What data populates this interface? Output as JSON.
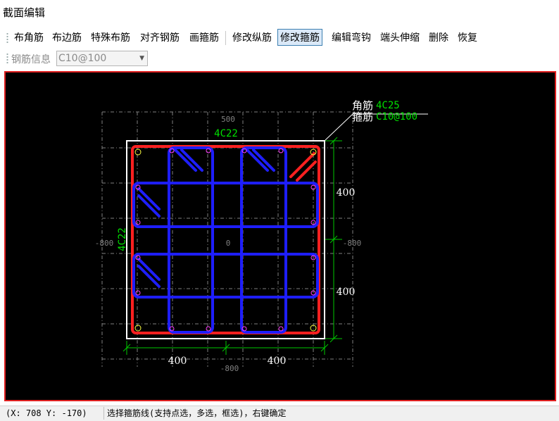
{
  "window": {
    "title": "截面编辑"
  },
  "toolbar": {
    "buttons": [
      "布角筋",
      "布边筋",
      "特殊布筋",
      "对齐钢筋",
      "画箍筋",
      "修改纵筋",
      "修改箍筋",
      "编辑弯钩",
      "端头伸缩",
      "删除",
      "恢复"
    ],
    "active_button": "修改箍筋"
  },
  "rebar_info": {
    "label": "钢筋信息",
    "value": "C10@100"
  },
  "drawing": {
    "top_rebar_label": "4C22",
    "left_rebar_label": "4C22",
    "leader": {
      "corner_title": "角筋",
      "corner_value": "4C25",
      "stirrup_title": "箍筋",
      "stirrup_value": "C10@100"
    },
    "dimensions": {
      "top_width": "500",
      "bottom_width": "-800",
      "left": "-800",
      "right": "-800",
      "center": "0",
      "right_upper": "400",
      "right_lower": "400",
      "bottom_left": "400",
      "bottom_right": "400"
    },
    "colors": {
      "background": "#000000",
      "section": "#ffffff",
      "main_rebar": "#ff2020",
      "stirrup": "#1e1eff",
      "dimension": "#00c800",
      "grid": "#808080",
      "label_green": "#00e000",
      "point": "#ff40ff"
    }
  },
  "status": {
    "coord": "(X: 708 Y: -170)",
    "message": "选择箍筋线(支持点选，多选，框选)，右键确定"
  }
}
